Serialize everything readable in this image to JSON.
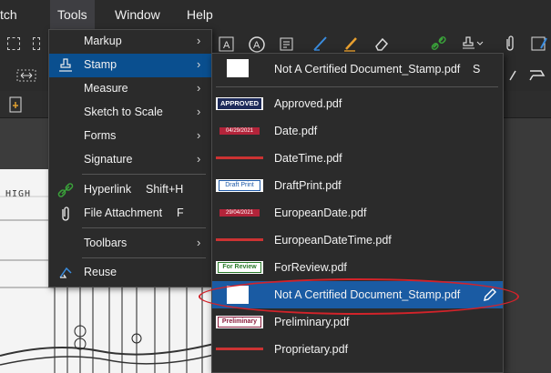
{
  "menubar": {
    "items": [
      "tch",
      "Tools",
      "Window",
      "Help"
    ]
  },
  "tools_menu": {
    "items": [
      {
        "label": "Markup",
        "icon": "",
        "shortcut": "",
        "submenu": true
      },
      {
        "label": "Stamp",
        "icon": "stamp-icon",
        "shortcut": "",
        "submenu": true,
        "highlighted": true
      },
      {
        "label": "Measure",
        "icon": "",
        "shortcut": "",
        "submenu": true
      },
      {
        "label": "Sketch to Scale",
        "icon": "",
        "shortcut": "",
        "submenu": true
      },
      {
        "label": "Forms",
        "icon": "",
        "shortcut": "",
        "submenu": true
      },
      {
        "label": "Signature",
        "icon": "",
        "shortcut": "",
        "submenu": true
      },
      {
        "label": "Hyperlink",
        "icon": "link-icon",
        "shortcut": "Shift+H",
        "submenu": false
      },
      {
        "label": "File Attachment",
        "icon": "paperclip-icon",
        "shortcut": "F",
        "submenu": false
      },
      {
        "label": "Toolbars",
        "icon": "",
        "shortcut": "",
        "submenu": true
      },
      {
        "label": "Reuse",
        "icon": "reuse-icon",
        "shortcut": "",
        "submenu": false
      }
    ],
    "arrow": "›"
  },
  "stamp_menu": {
    "current": {
      "label": "Not A Certified Document_Stamp.pdf",
      "shortcut": "S"
    },
    "items": [
      {
        "label": "Approved.pdf",
        "thumb_text": "APPROVED"
      },
      {
        "label": "Date.pdf",
        "thumb_text": "04/29/2021"
      },
      {
        "label": "DateTime.pdf",
        "thumb_text": ""
      },
      {
        "label": "DraftPrint.pdf",
        "thumb_text": "Draft Print"
      },
      {
        "label": "EuropeanDate.pdf",
        "thumb_text": "29/04/2021"
      },
      {
        "label": "EuropeanDateTime.pdf",
        "thumb_text": ""
      },
      {
        "label": "ForReview.pdf",
        "thumb_text": "For Review"
      },
      {
        "label": "Not A Certified Document_Stamp.pdf",
        "thumb_text": "",
        "highlighted": true
      },
      {
        "label": "Preliminary.pdf",
        "thumb_text": "Preliminary"
      },
      {
        "label": "Proprietary.pdf",
        "thumb_text": ""
      }
    ]
  },
  "document": {
    "text": "HIGH"
  },
  "colors": {
    "menu_bg": "#2b2b2b",
    "menu_highlight": "#0a4f8f",
    "submenu_highlight": "#1a5ba3",
    "annotation_oval": "#d2232a",
    "link_icon": "#3aa33a",
    "pen_icon": "#3a8de0"
  }
}
